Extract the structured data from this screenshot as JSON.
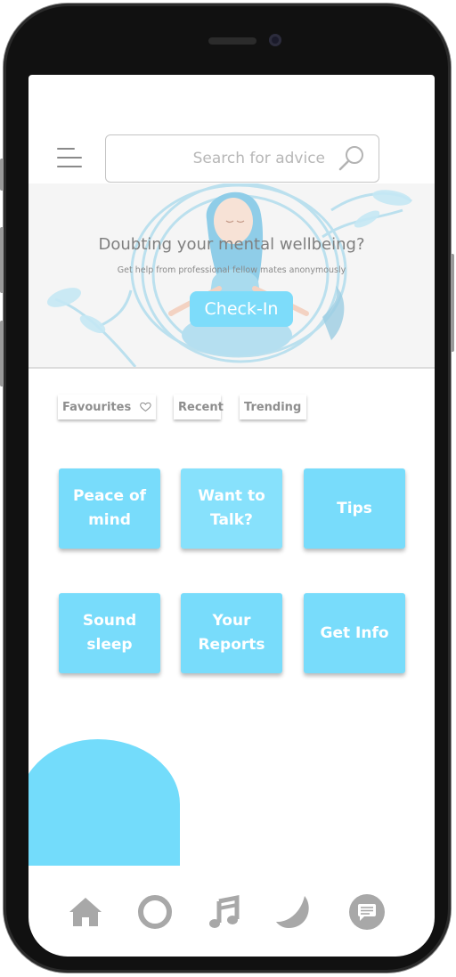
{
  "search": {
    "placeholder": "Search for advice"
  },
  "hero": {
    "title": "Doubting your mental wellbeing?",
    "subtitle": "Get help from professional fellow mates anonymously",
    "cta_label": "Check-In"
  },
  "filters": {
    "favourites": "Favourites",
    "recent": "Recent",
    "trending": "Trending"
  },
  "tiles": [
    {
      "label": "Peace of\nmind"
    },
    {
      "label": "Want to\nTalk?"
    },
    {
      "label": "Tips"
    },
    {
      "label": "Sound sleep"
    },
    {
      "label": "Your\nReports"
    },
    {
      "label": "Get Info"
    }
  ],
  "bottom_nav": [
    "home-icon",
    "circle-icon",
    "music-icon",
    "moon-icon",
    "chat-icon"
  ],
  "colors": {
    "accent": "#78dcfb",
    "accent_light": "#87e1fc",
    "hero_art": "#a9dbee",
    "icon_gray": "#a8a8a8",
    "text_gray": "#8e8e8e"
  }
}
